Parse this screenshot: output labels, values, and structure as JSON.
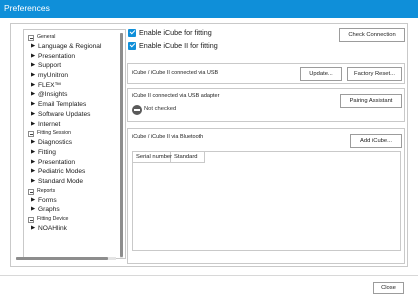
{
  "window": {
    "title": "Preferences"
  },
  "tree": {
    "groups": [
      {
        "label": "General",
        "items": [
          "Language & Regional",
          "Presentation",
          "Support",
          "myUnitron",
          "FLEX™",
          "@Insights",
          "Email Templates",
          "Software Updates",
          "Internet"
        ]
      },
      {
        "label": "Fitting Session",
        "items": [
          "Diagnostics",
          "Fitting",
          "Presentation",
          "Pediatric Modes",
          "Standard Mode"
        ]
      },
      {
        "label": "Reports",
        "items": [
          "Forms",
          "Graphs"
        ]
      },
      {
        "label": "Fitting Device",
        "items": [
          "NOAHlink"
        ]
      }
    ]
  },
  "options": {
    "enable_icube": "Enable iCube for fitting",
    "enable_icube_ii": "Enable iCube II for fitting",
    "check_connection": "Check Connection"
  },
  "usb_panel": {
    "title": "iCube / iCube II connected via USB",
    "update_button": "Update...",
    "factory_reset_button": "Factory Reset..."
  },
  "adapter_panel": {
    "title": "iCube II connected via USB adapter",
    "pairing_button": "Pairing Assistant",
    "status": "Not checked"
  },
  "bluetooth_panel": {
    "title": "iCube / iCube II via Bluetooth",
    "add_button": "Add iCube...",
    "columns": [
      "Serial number",
      "Standard"
    ]
  },
  "footer": {
    "close_button": "Close"
  }
}
